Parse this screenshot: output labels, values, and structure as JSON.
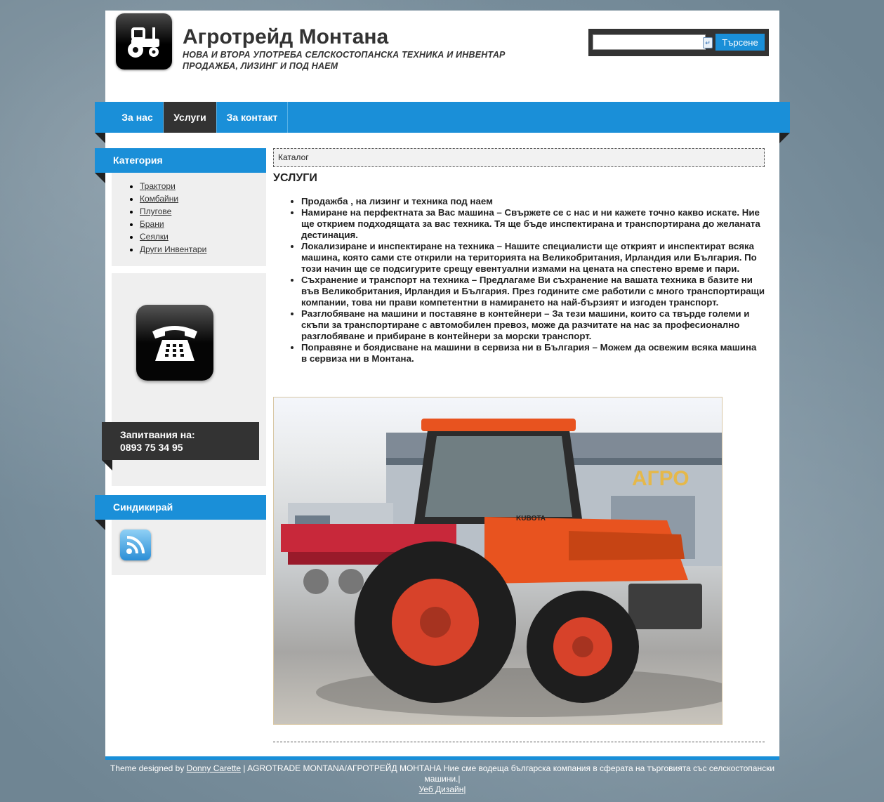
{
  "header": {
    "title": "Агротрейд Монтана",
    "slogan_line1": "НОВА И ВТОРА УПОТРЕБА СЕЛСКОСТОПАНСКА ТЕХНИКА И ИНВЕНТАР",
    "slogan_line2": "ПРОДАЖБА, ЛИЗИНГ И ПОД НАЕМ",
    "logo_icon": "tractor-icon"
  },
  "search": {
    "value": "",
    "placeholder": "",
    "button_label": "Търсене"
  },
  "nav": {
    "items": [
      {
        "label": "За нас",
        "active": false
      },
      {
        "label": "Услуги",
        "active": true
      },
      {
        "label": "За контакт",
        "active": false
      }
    ]
  },
  "sidebar": {
    "category_title": "Категория",
    "categories": [
      "Трактори",
      "Комбайни",
      "Плугове",
      "Брани",
      "Сеялки",
      "Други Инвентари"
    ],
    "inquiry_label": "Запитвания на:",
    "phone": "0893 75 34 95",
    "syndicate_title": "Синдикирай"
  },
  "content": {
    "breadcrumb": "Каталог",
    "heading": "УСЛУГИ",
    "services": [
      "Продажба , на лизинг и техника под наем",
      "Намиране на перфектната за Вас машина – Свържете се с нас и ни кажете точно какво искате. Ние ще открием подходящата за вас техника. Тя ще бъде инспектирана и транспортирана до желаната дестинация.",
      "Локализиране и инспектиране на техника – Нашите специалисти ще открият и инспектират всяка машина, която сами сте открили на територията на Великобритания, Ирландия или България. По този начин ще се подсигурите срещу евентуални измами на цената на спестено време и пари.",
      "Съхранение и транспорт на техника – Предлагаме Ви съхранение на вашата техника в базите ни във Великобритания, Ирландия и България. През годините сме работили с много транспортиращи компании, това ни прави компетентни в намирането на най-бързият и изгоден транспорт.",
      "Разглобяване на машини и поставяне в контейнери – За тези машини, които са твърде големи и скъпи за транспортиране с автомобилен превоз, може да разчитате на нас за професионално разглобяване и прибиране в контейнери за морски транспорт.",
      "Поправяне и боядисване на машини в сервиза ни в България – Можем да освежим всяка машина в сервиза ни в Монтана."
    ],
    "photo": {
      "building_sign": "АГРО",
      "tractor_brand": "KUBOTA"
    }
  },
  "footer": {
    "prefix": "Theme designed by ",
    "designer_link": "Donny Carette",
    "text": " | AGROTRADE MONTANA/АГРОТРЕЙД МОНТАНА Ние сме водеща българска компания в сферата на търговията със селскостопански машини.|",
    "web_design_link": "Уеб Дизайн",
    "suffix": "|"
  },
  "colors": {
    "accent": "#1a8fd8",
    "dark": "#333333",
    "tractor_orange": "#e8531f"
  }
}
